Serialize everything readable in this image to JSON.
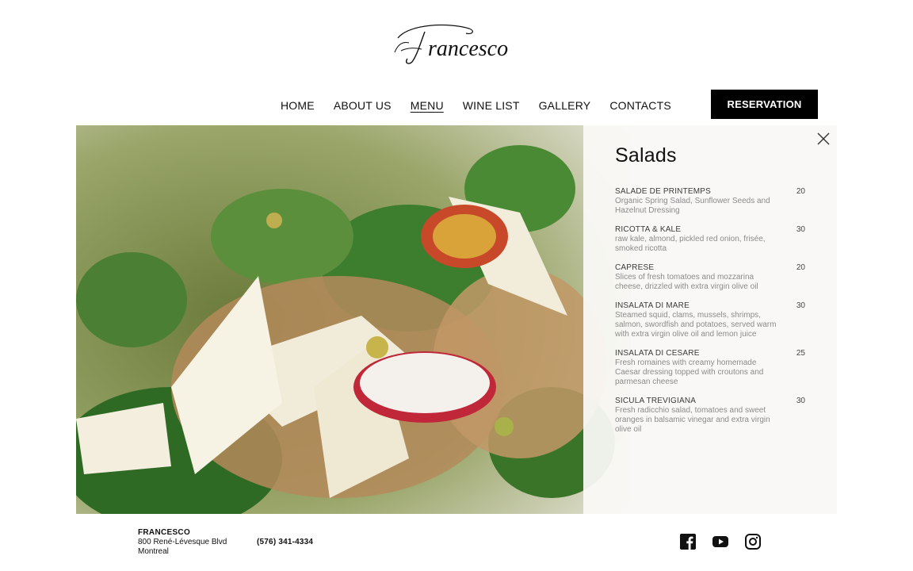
{
  "brand": {
    "logo_text": "Francesco"
  },
  "nav": {
    "items": [
      {
        "label": "HOME"
      },
      {
        "label": "ABOUT US"
      },
      {
        "label": "MENU",
        "active": true
      },
      {
        "label": "WINE LIST"
      },
      {
        "label": "GALLERY"
      },
      {
        "label": "CONTACTS"
      }
    ],
    "reservation_label": "RESERVATION"
  },
  "hero": {
    "image_icon": "salad-photo"
  },
  "menu_panel": {
    "title": "Salads",
    "close_icon": "close-icon",
    "items": [
      {
        "name": "SALADE DE PRINTEMPS",
        "price": "20",
        "description": "Organic Spring Salad, Sunflower Seeds and Hazelnut Dressing"
      },
      {
        "name": "RICOTTA & KALE",
        "price": "30",
        "description": "raw kale, almond, pickled red onion, frisée, smoked ricotta"
      },
      {
        "name": "CAPRESE",
        "price": "20",
        "description": "Slices of fresh tomatoes and mozzarina cheese, drizzled with extra virgin olive oil"
      },
      {
        "name": "INSALATA DI MARE",
        "price": "30",
        "description": "Steamed squid, clams, mussels, shrimps, salmon, swordfish and potatoes, served warm with extra virgin olive oil and lemon juice"
      },
      {
        "name": "INSALATA DI CESARE",
        "price": "25",
        "description": "Fresh romaines with creamy homemade Caesar dressing topped with croutons and parmesan cheese"
      },
      {
        "name": "SICULA TREVIGIANA",
        "price": "30",
        "description": "Fresh radicchio salad, tomatoes and sweet oranges in balsamic vinegar and extra virgin olive oil"
      }
    ]
  },
  "footer": {
    "brand_name": "FRANCESCO",
    "address_line1": "800 René-Lévesque Blvd",
    "address_line2": "Montreal",
    "phone": "(576) 341-4334",
    "socials": [
      {
        "icon": "facebook-icon"
      },
      {
        "icon": "youtube-icon"
      },
      {
        "icon": "instagram-icon"
      }
    ]
  },
  "colors": {
    "accent": "#000000",
    "panel_bg": "#faf9f7",
    "muted_text": "#8b8b8b"
  }
}
